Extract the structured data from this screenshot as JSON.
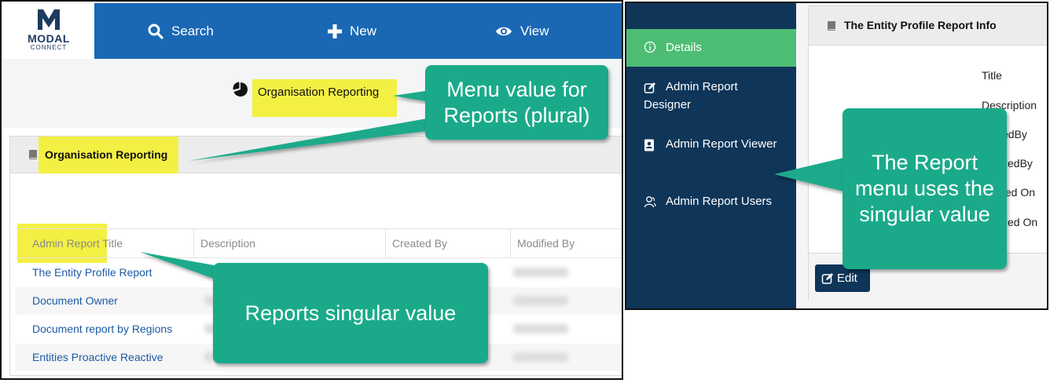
{
  "app": {
    "logo_name": "MODAL",
    "logo_sub": "CONNECT"
  },
  "topnav": {
    "search_label": "Search",
    "new_label": "New",
    "view_label": "View"
  },
  "org_heading": "Organisation Reporting",
  "panel": {
    "title": "Organisation Reporting"
  },
  "table": {
    "headers": [
      "Admin Report Title",
      "Description",
      "Created By",
      "Modified By"
    ],
    "rows": [
      {
        "title": "The Entity Profile Report"
      },
      {
        "title": "Document Owner"
      },
      {
        "title": "Document report by Regions"
      },
      {
        "title": "Entities Proactive Reactive"
      }
    ]
  },
  "sidebar": {
    "items": [
      {
        "label": "Details",
        "icon": "info-circle-icon"
      },
      {
        "label": "Admin Report Designer",
        "icon": "edit-square-icon"
      },
      {
        "label": "Admin Report Viewer",
        "icon": "contact-book-icon"
      },
      {
        "label": "Admin Report Users",
        "icon": "users-icon"
      }
    ]
  },
  "detail_panel": {
    "title": "The Entity Profile Report Info",
    "fields": [
      "Title",
      "Description",
      "CreatedBy",
      "ModifiedBy",
      "Created On",
      "Modified On"
    ],
    "fields_visible": [
      "Title",
      "Description",
      "edBy",
      "fiedBy",
      "ted On",
      "fied On"
    ],
    "edit_label": "Edit"
  },
  "callouts": {
    "plural": "Menu value for\nReports (plural)",
    "singular": "Reports singular value",
    "menu": "The Report\nmenu uses the\nsingular value"
  },
  "colors": {
    "nav_blue": "#1a68b4",
    "sidebar_navy": "#0f3558",
    "active_green": "#4dbd74",
    "callout_teal": "#1aaa8a",
    "highlight_yellow": "#f3f043",
    "link_blue": "#1c5aa6"
  }
}
